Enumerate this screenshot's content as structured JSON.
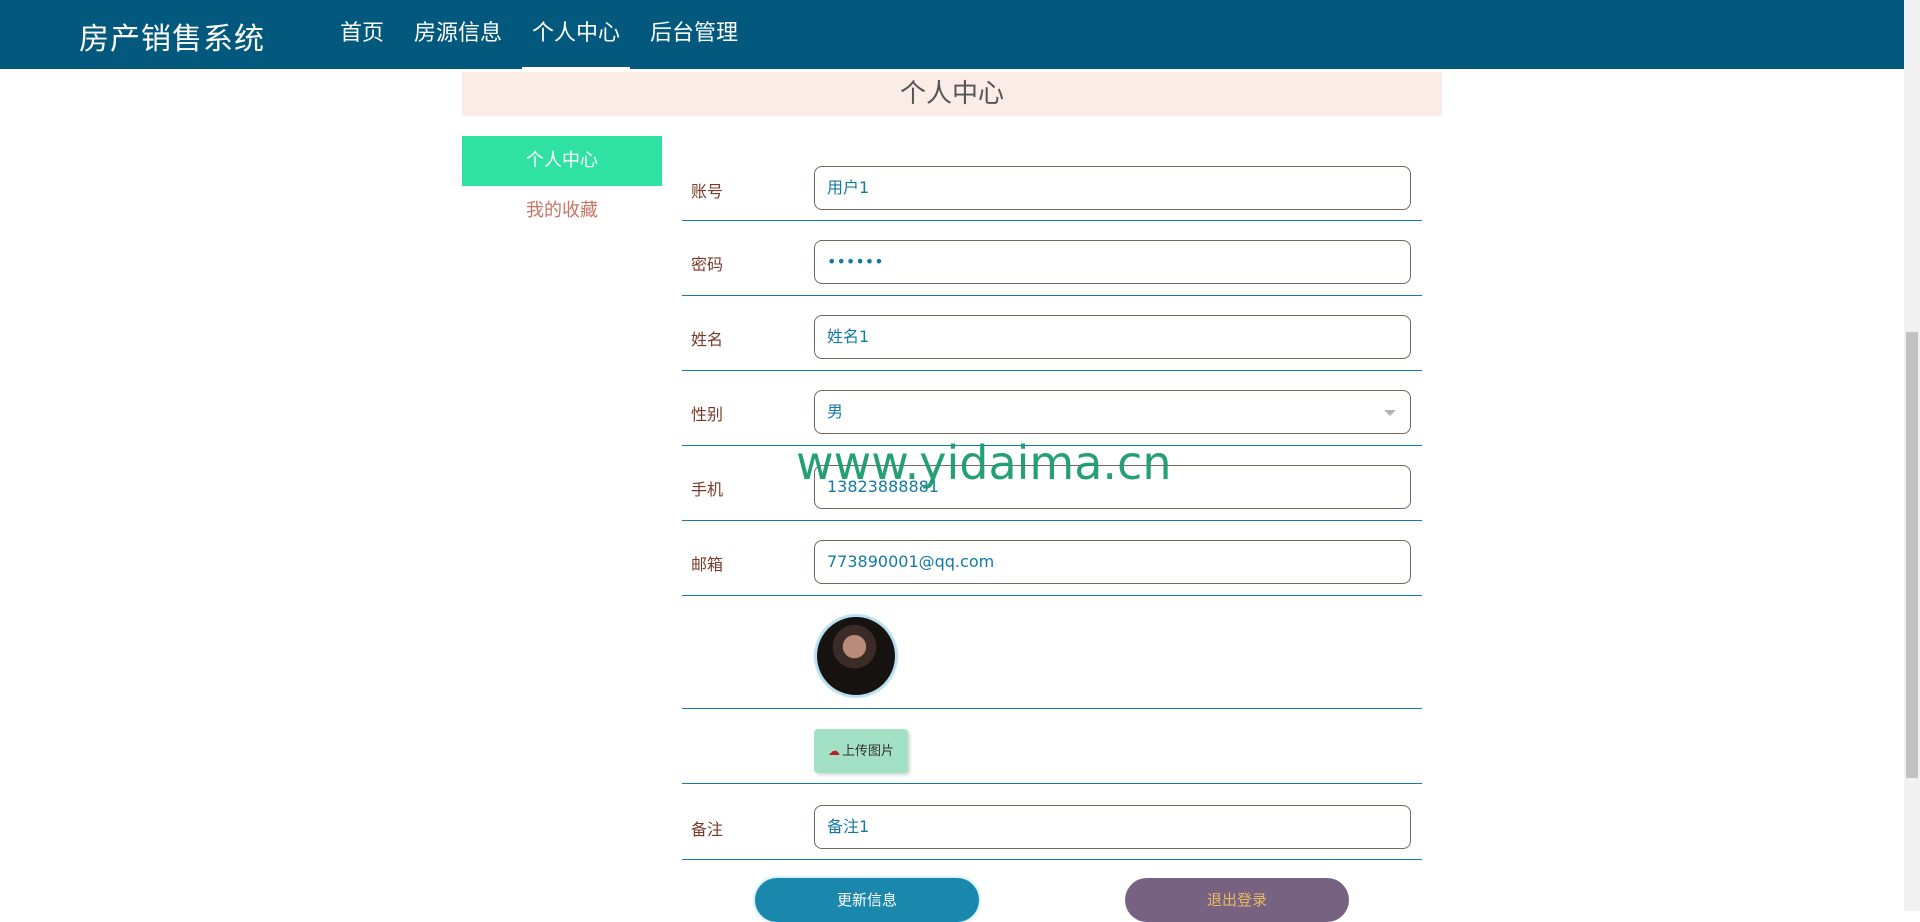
{
  "brand": "房产销售系统",
  "nav": [
    "首页",
    "房源信息",
    "个人中心",
    "后台管理"
  ],
  "page_title": "个人中心",
  "side": [
    "个人中心",
    "我的收藏"
  ],
  "form": {
    "account": {
      "label": "账号",
      "value": "用户1"
    },
    "password": {
      "label": "密码",
      "value": "••••••"
    },
    "name": {
      "label": "姓名",
      "value": "姓名1"
    },
    "gender": {
      "label": "性别",
      "value": "男"
    },
    "phone": {
      "label": "手机",
      "value": "13823888881"
    },
    "email": {
      "label": "邮箱",
      "value": "773890001@qq.com"
    },
    "upload_label": "上传图片",
    "note": {
      "label": "备注",
      "value": "备注1"
    }
  },
  "buttons": {
    "update": "更新信息",
    "logout": "退出登录"
  },
  "watermark": "www.yidaima.cn",
  "colors": {
    "topbar": "#03597d",
    "active_side": "#2fe2a4",
    "update_button": "#1a87ac",
    "logout_button": "#776282"
  }
}
